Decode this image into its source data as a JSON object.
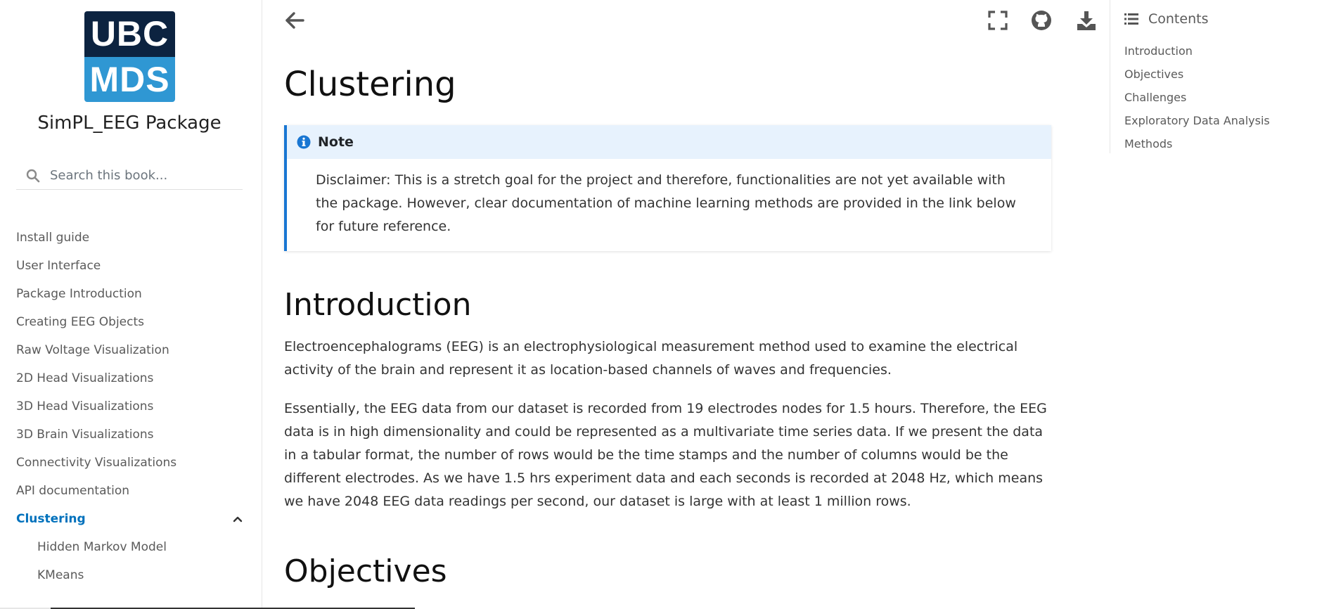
{
  "logo": {
    "line1": "UBC",
    "line2": "MDS"
  },
  "site_title": "SimPL_EEG Package",
  "search": {
    "placeholder": "Search this book..."
  },
  "nav": {
    "items": [
      {
        "label": "Install guide"
      },
      {
        "label": "User Interface"
      },
      {
        "label": "Package Introduction"
      },
      {
        "label": "Creating EEG Objects"
      },
      {
        "label": "Raw Voltage Visualization"
      },
      {
        "label": "2D Head Visualizations"
      },
      {
        "label": "3D Head Visualizations"
      },
      {
        "label": "3D Brain Visualizations"
      },
      {
        "label": "Connectivity Visualizations"
      },
      {
        "label": "API documentation"
      },
      {
        "label": "Clustering"
      },
      {
        "label": "Hidden Markov Model"
      },
      {
        "label": "KMeans"
      }
    ]
  },
  "page": {
    "title": "Clustering",
    "note": {
      "title": "Note",
      "text": "Disclaimer: This is a stretch goal for the project and therefore, functionalities are not yet available with the package. However, clear documentation of machine learning methods are provided in the link below for future reference."
    },
    "introduction": {
      "heading": "Introduction",
      "p1": "Electroencephalograms (EEG) is an electrophysiological measurement method used to examine the electrical activity of the brain and represent it as location-based channels of waves and frequencies.",
      "p2": "Essentially, the EEG data from our dataset is recorded from 19 electrodes nodes for 1.5 hours. Therefore, the EEG data is in high dimensionality and could be represented as a multivariate time series data. If we present the data in a tabular format, the number of rows would be the time stamps and the number of columns would be the different electrodes. As we have 1.5 hrs experiment data and each seconds is recorded at 2048 Hz, which means we have 2048 EEG data readings per second, our dataset is large with at least 1 million rows."
    },
    "objectives": {
      "heading": "Objectives"
    }
  },
  "toc": {
    "title": "Contents",
    "items": [
      {
        "label": "Introduction"
      },
      {
        "label": "Objectives"
      },
      {
        "label": "Challenges"
      },
      {
        "label": "Exploratory Data Analysis"
      },
      {
        "label": "Methods"
      }
    ]
  },
  "icons": {
    "back": "arrow-left-icon",
    "fullscreen": "fullscreen-icon",
    "github": "github-icon",
    "download": "download-icon",
    "search": "search-icon",
    "toc": "list-icon",
    "chevron": "chevron-up-icon",
    "info": "info-icon"
  },
  "colors": {
    "accent": "#0071bc",
    "note_border": "#1976d2",
    "note_bg": "#e7f2fd",
    "logo_dark": "#0c2340",
    "logo_light": "#2f97d3"
  }
}
